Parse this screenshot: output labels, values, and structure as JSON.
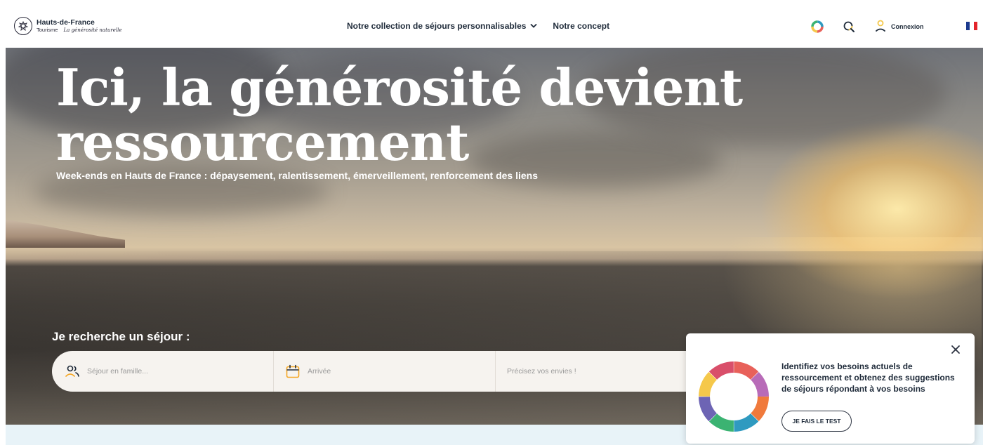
{
  "header": {
    "logo": {
      "name": "Hauts-de-France",
      "sub": "Tourisme",
      "slogan": "La générosité naturelle"
    },
    "nav": [
      {
        "label": "Notre collection de séjours personnalisables",
        "icon": "chevron-down-icon"
      },
      {
        "label": "Notre concept"
      }
    ],
    "tools": {
      "ring_icon": "color-ring-icon",
      "search_icon": "search-icon",
      "user_icon": "user-icon",
      "login_label": "Connexion",
      "flag_icon": "french-flag-icon"
    }
  },
  "hero": {
    "headline": "Ici, la générosité devient ressourcement",
    "subline": "Week-ends en Hauts de France : dépaysement, ralentissement, émerveillement, renforcement des liens"
  },
  "search": {
    "title": "Je recherche un séjour :",
    "fields": [
      {
        "placeholder": "Séjour en famille...",
        "icon": "group-icon"
      },
      {
        "placeholder": "Arrivée",
        "icon": "calendar-icon"
      },
      {
        "placeholder": "Précisez vos envies !"
      }
    ]
  },
  "popup": {
    "text": "Identifiez vos besoins actuels de ressourcement et obtenez des suggestions de séjours répondant à vos besoins",
    "button_label": "JE FAIS LE TEST",
    "close_icon": "close-icon",
    "donut_colors": [
      "#e8615a",
      "#b86bb8",
      "#f07a3c",
      "#2f9ac0",
      "#3bb372",
      "#6d64b4",
      "#f5c84b",
      "#d94f6a"
    ]
  },
  "colors": {
    "text_dark": "#1f2b3a",
    "bottom_strip": "#e8f3f8",
    "flag_blue": "#1c3a8e",
    "flag_red": "#e3242b"
  }
}
